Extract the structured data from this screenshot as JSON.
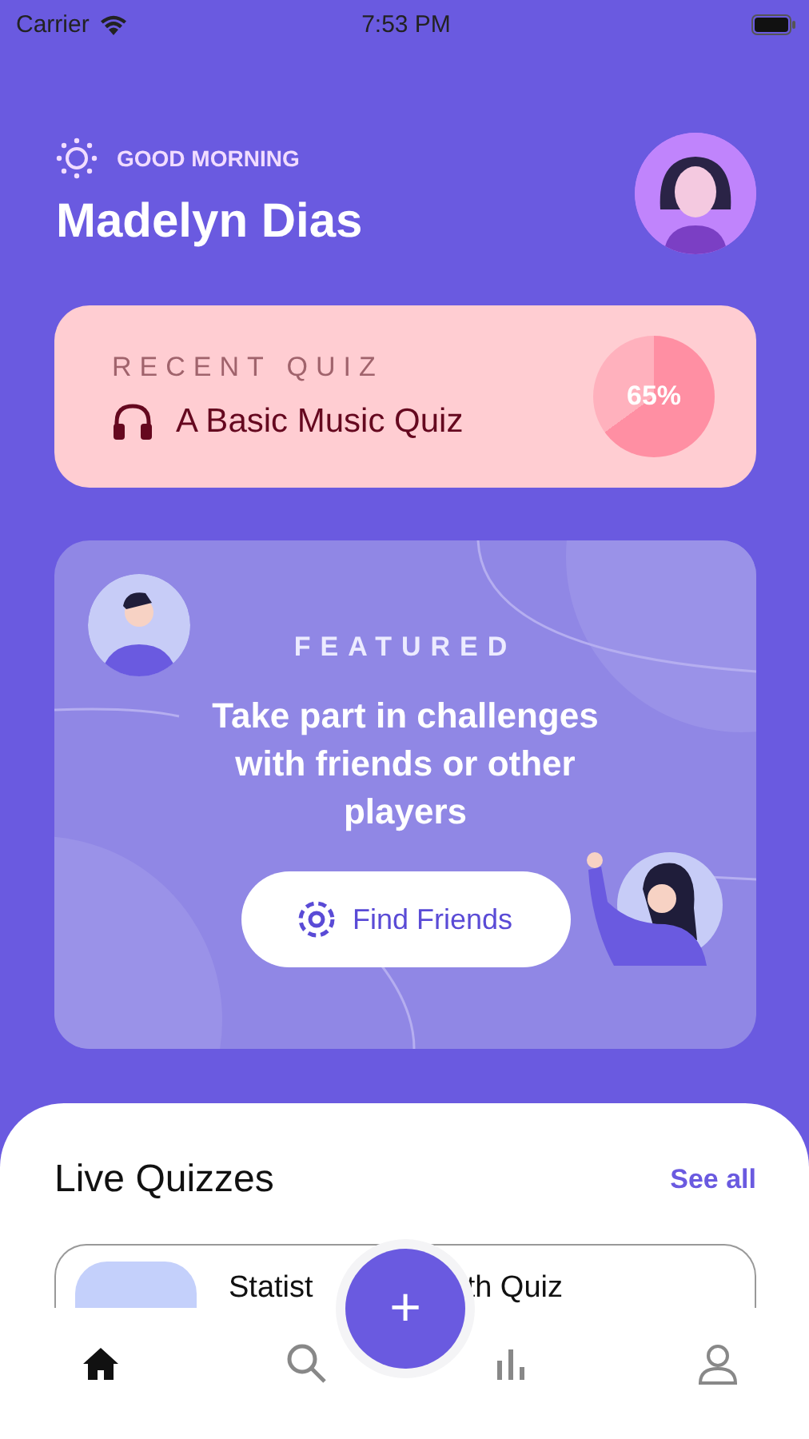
{
  "status_bar": {
    "carrier": "Carrier",
    "time": "7:53 PM"
  },
  "header": {
    "greeting": "GOOD MORNING",
    "name": "Madelyn Dias"
  },
  "recent_quiz": {
    "label": "RECENT QUIZ",
    "title": "A Basic Music Quiz",
    "progress": "65%"
  },
  "featured": {
    "label": "FEATURED",
    "text": "Take part in challenges with friends or other players",
    "button": "Find Friends"
  },
  "live_quizzes": {
    "title": "Live Quizzes",
    "link": "See all",
    "items": [
      {
        "title_parts": [
          "Statist",
          "th Quiz"
        ]
      }
    ]
  },
  "fab": "+",
  "nav": [
    {
      "kind": "home",
      "selected": true
    },
    {
      "kind": "search",
      "selected": false
    },
    {
      "kind": "stats",
      "selected": false
    },
    {
      "kind": "profile",
      "selected": false
    }
  ]
}
